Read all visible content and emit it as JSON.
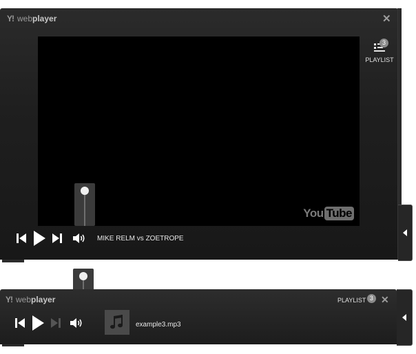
{
  "large_player": {
    "brand": {
      "logo_text": "Y!",
      "name_light": "web",
      "name_bold": "player"
    },
    "close_glyph": "✕",
    "playlist": {
      "label": "PLAYLIST",
      "count": "3",
      "icon": "playlist-icon"
    },
    "video_watermark": {
      "you": "You",
      "tube": "Tube"
    },
    "now_playing": "MIKE RELM vs ZOETROPE",
    "volume_level": 0.85,
    "icons": [
      "skip-back-icon",
      "play-icon",
      "skip-forward-icon",
      "volume-icon",
      "chevron-left-icon"
    ]
  },
  "small_player": {
    "brand": {
      "logo_text": "Y!",
      "name_light": "web",
      "name_bold": "player"
    },
    "close_glyph": "✕",
    "playlist": {
      "label": "PLAYLIST",
      "count": "3"
    },
    "now_playing": "example3.mp3",
    "volume_level": 0.85,
    "icons": [
      "skip-back-icon",
      "play-icon",
      "skip-forward-icon",
      "volume-icon",
      "music-note-icon",
      "chevron-left-icon"
    ]
  },
  "colors": {
    "player_bg": "#1f1f1f",
    "icon": "#ffffff",
    "muted_text": "#9a9a9a",
    "video_bg": "#000000"
  }
}
